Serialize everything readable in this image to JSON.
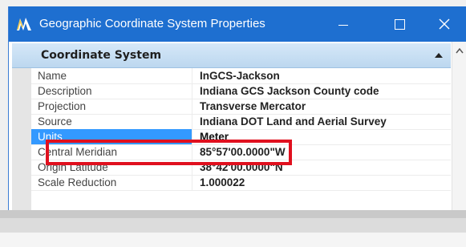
{
  "window": {
    "title": "Geographic Coordinate System Properties",
    "controls": {
      "minimize": "—",
      "maximize": "☐",
      "close": "✕"
    }
  },
  "section": {
    "title": "Coordinate System"
  },
  "properties": [
    {
      "name": "Name",
      "value": "InGCS-Jackson"
    },
    {
      "name": "Description",
      "value": "Indiana GCS Jackson County code"
    },
    {
      "name": "Projection",
      "value": "Transverse Mercator"
    },
    {
      "name": "Source",
      "value": "Indiana DOT Land and Aerial Survey"
    },
    {
      "name": "Units",
      "value": "Meter",
      "selected": true
    },
    {
      "name": "Central Meridian",
      "value": "85°57'00.0000\"W"
    },
    {
      "name": "Origin Latitude",
      "value": "38°42'00.0000\"N"
    },
    {
      "name": "Scale Reduction",
      "value": "1.000022"
    }
  ],
  "colors": {
    "titlebar": "#1e6fd0",
    "selection": "#3399ff",
    "highlight": "#e0101e"
  },
  "icons": {
    "app": "microstation-icon",
    "collapse": "chevron-up-icon",
    "scroll_up": "scroll-up-arrow-icon"
  }
}
